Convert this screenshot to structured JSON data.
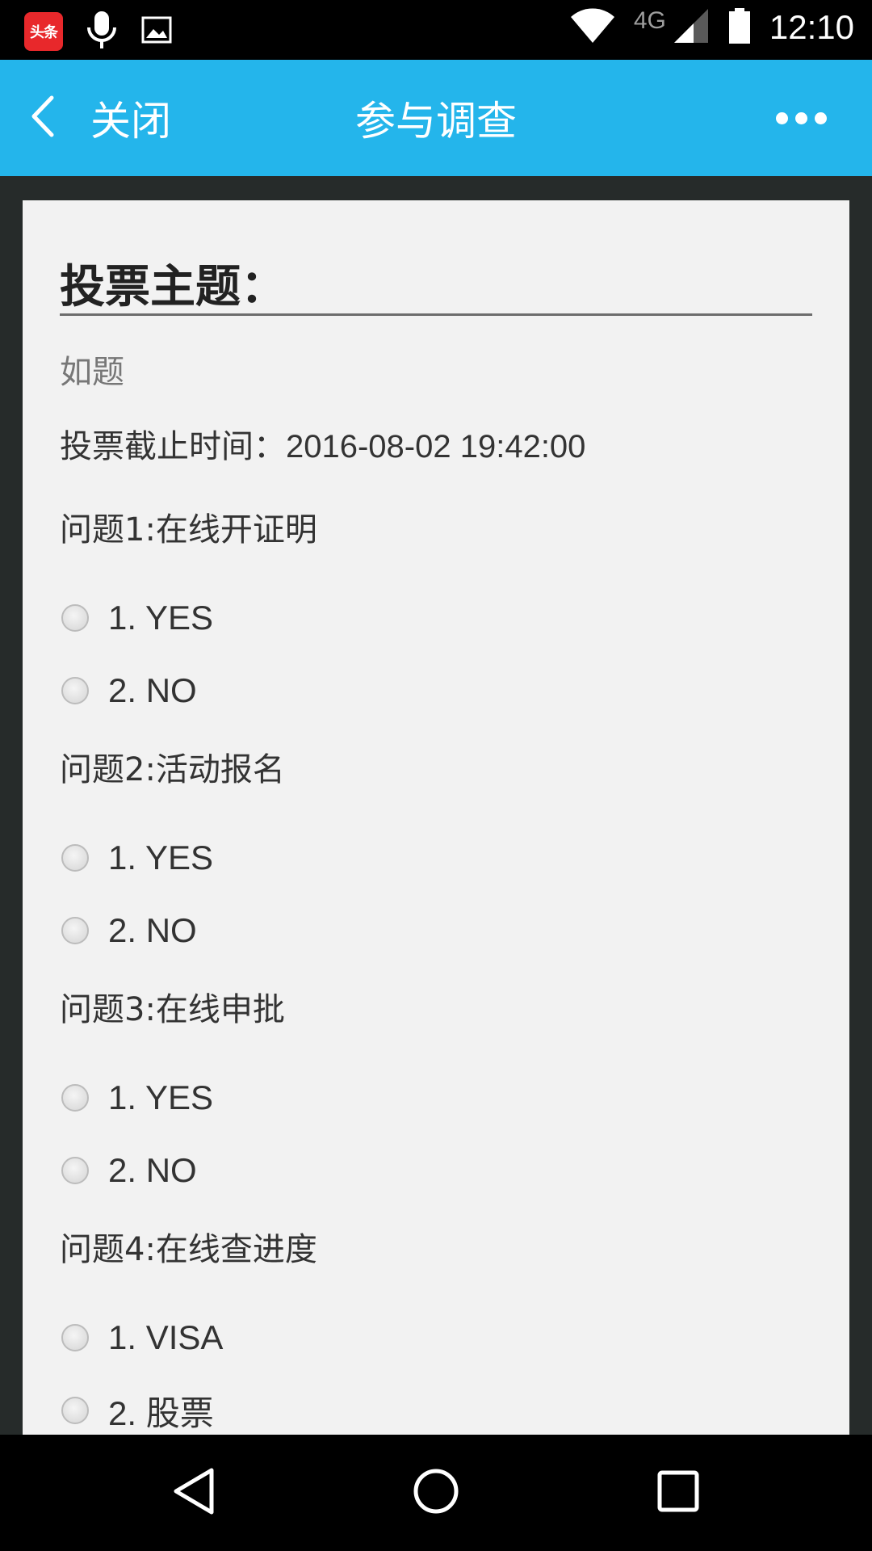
{
  "status_bar": {
    "app_icon_text": "头条",
    "network_label": "4G",
    "time": "12:10"
  },
  "app_bar": {
    "back_label": "关闭",
    "title": "参与调查"
  },
  "survey": {
    "topic_title": "投票主题：",
    "description": "如题",
    "deadline_label": "投票截止时间：",
    "deadline_value": "2016-08-02 19:42:00",
    "questions": [
      {
        "title": "问题1:在线开证明",
        "options": [
          "1. YES",
          "2. NO"
        ]
      },
      {
        "title": "问题2:活动报名",
        "options": [
          "1. YES",
          "2. NO"
        ]
      },
      {
        "title": "问题3:在线申批",
        "options": [
          "1. YES",
          "2. NO"
        ]
      },
      {
        "title": "问题4:在线查进度",
        "options": [
          "1. VISA",
          "2. 股票"
        ]
      }
    ]
  },
  "colors": {
    "app_bar": "#24b5eb",
    "content_background": "#262b2a",
    "card": "#f2f2f2"
  }
}
